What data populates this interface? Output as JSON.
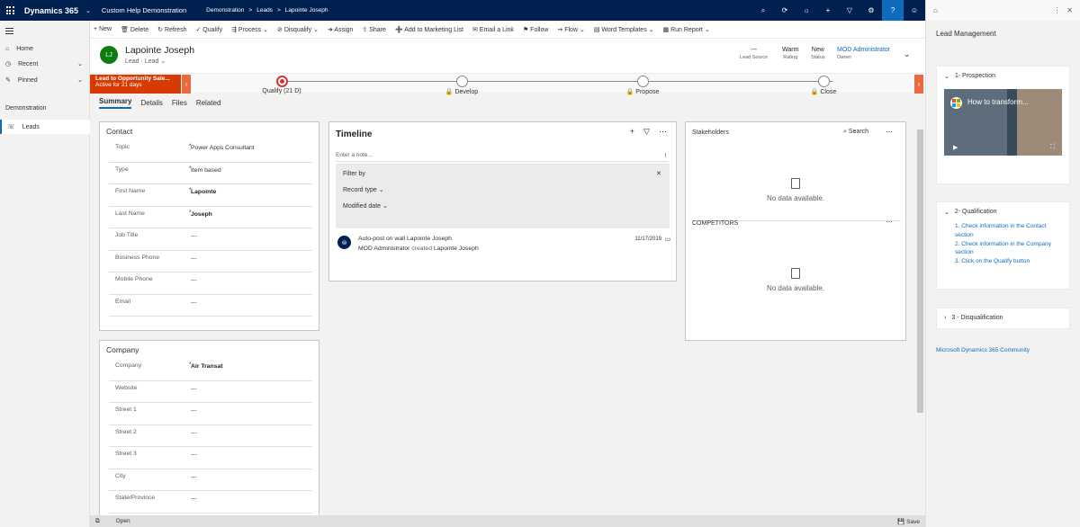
{
  "topbar": {
    "app_name": "Dynamics 365",
    "app_title": "Custom Help Demonstration",
    "breadcrumbs": [
      "Demonstration",
      ">",
      "Leads",
      ">",
      "Lapointe Joseph"
    ]
  },
  "nav": {
    "home": "Home",
    "recent": "Recent",
    "pinned": "Pinned",
    "group": "Demonstration",
    "leads": "Leads"
  },
  "commands": [
    "New",
    "Delete",
    "Refresh",
    "Qualify",
    "Process",
    "Disqualify",
    "Assign",
    "Share",
    "Add to Marketing List",
    "Email a Link",
    "Follow",
    "Flow",
    "Word Templates",
    "Run Report"
  ],
  "record": {
    "initials": "LJ",
    "name": "Lapointe Joseph",
    "entity": "Lead",
    "form": "Lead",
    "lead_source_val": "---",
    "lead_source_label": "Lead Source",
    "rating_val": "Warm",
    "rating_label": "Rating",
    "status_val": "New",
    "status_label": "Status",
    "owner_val": "MOD Administrator",
    "owner_label": "Owner"
  },
  "bpf": {
    "flag_title": "Lead to Opportunity Sale...",
    "flag_sub": "Active for 21 days",
    "stages": [
      "Qualify  (21 D)",
      "Develop",
      "Propose",
      "Close"
    ]
  },
  "tabs": [
    "Summary",
    "Details",
    "Files",
    "Related"
  ],
  "contact": {
    "title": "Contact",
    "fields": [
      {
        "label": "Topic",
        "value": "Power Apps Consultant"
      },
      {
        "label": "Type",
        "value": "Item based"
      },
      {
        "label": "First Name",
        "value": "Lapointe"
      },
      {
        "label": "Last Name",
        "value": "Joseph"
      },
      {
        "label": "Job Title",
        "value": "---"
      },
      {
        "label": "Business Phone",
        "value": "---"
      },
      {
        "label": "Mobile Phone",
        "value": "---"
      },
      {
        "label": "Email",
        "value": "---"
      }
    ]
  },
  "company": {
    "title": "Company",
    "fields": [
      {
        "label": "Company",
        "value": "Air Transat"
      },
      {
        "label": "Website",
        "value": "---"
      },
      {
        "label": "Street 1",
        "value": "---"
      },
      {
        "label": "Street 2",
        "value": "---"
      },
      {
        "label": "Street 3",
        "value": "---"
      },
      {
        "label": "City",
        "value": "---"
      },
      {
        "label": "State/Province",
        "value": "---"
      }
    ]
  },
  "timeline": {
    "title": "Timeline",
    "note_placeholder": "Enter a note...",
    "filter_by": "Filter by",
    "record_type": "Record type",
    "modified_date": "Modified date",
    "post_title": "Auto-post on wall Lapointe Joseph",
    "post_user": "MOD Administrator",
    "post_action": "created",
    "post_target": "Lapointe Joseph",
    "post_date": "11/17/2019"
  },
  "stakeholders": {
    "title": "Stakeholders",
    "search": "Search",
    "empty": "No data available.",
    "competitors": "COMPETITORS",
    "empty2": "No data available."
  },
  "rightpane": {
    "title": "Lead Management",
    "s1": "1- Prospection",
    "video_title": "How to transform...",
    "s2": "2- Qualification",
    "steps": [
      "1. Check information in the Contact section",
      "2. Check information in the Company section",
      "3. Click on the Qualify button"
    ],
    "s3": "3 - Disqualification",
    "link": "Microsoft Dynamics 365 Community"
  },
  "statusbar": {
    "left": "Open",
    "right": "Save"
  }
}
